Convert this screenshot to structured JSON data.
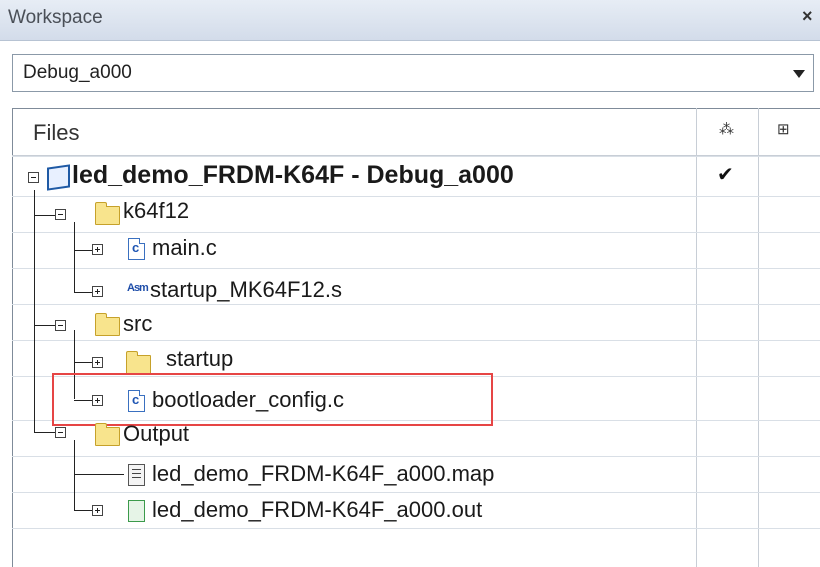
{
  "window": {
    "title": "Workspace",
    "close_label": "×"
  },
  "configuration": {
    "selected": "Debug_a000"
  },
  "header": {
    "files_label": "Files",
    "col1_icon": "compile-status-icon",
    "col2_icon": "options-icon"
  },
  "tree": {
    "project": {
      "name": "led_demo_FRDM-K64F - Debug_a000",
      "checked": "✔"
    },
    "k64f12": {
      "label": "k64f12",
      "children": [
        {
          "label": "main.c"
        },
        {
          "label": "startup_MK64F12.s"
        }
      ]
    },
    "src": {
      "label": "src",
      "children": [
        {
          "label": "startup"
        },
        {
          "label": "bootloader_config.c"
        }
      ]
    },
    "output": {
      "label": "Output",
      "children": [
        {
          "label": "led_demo_FRDM-K64F_a000.map"
        },
        {
          "label": "led_demo_FRDM-K64F_a000.out"
        }
      ]
    }
  },
  "colors": {
    "highlight": "#e64545",
    "folder": "#f8e48d",
    "project": "#1f5aa5"
  }
}
